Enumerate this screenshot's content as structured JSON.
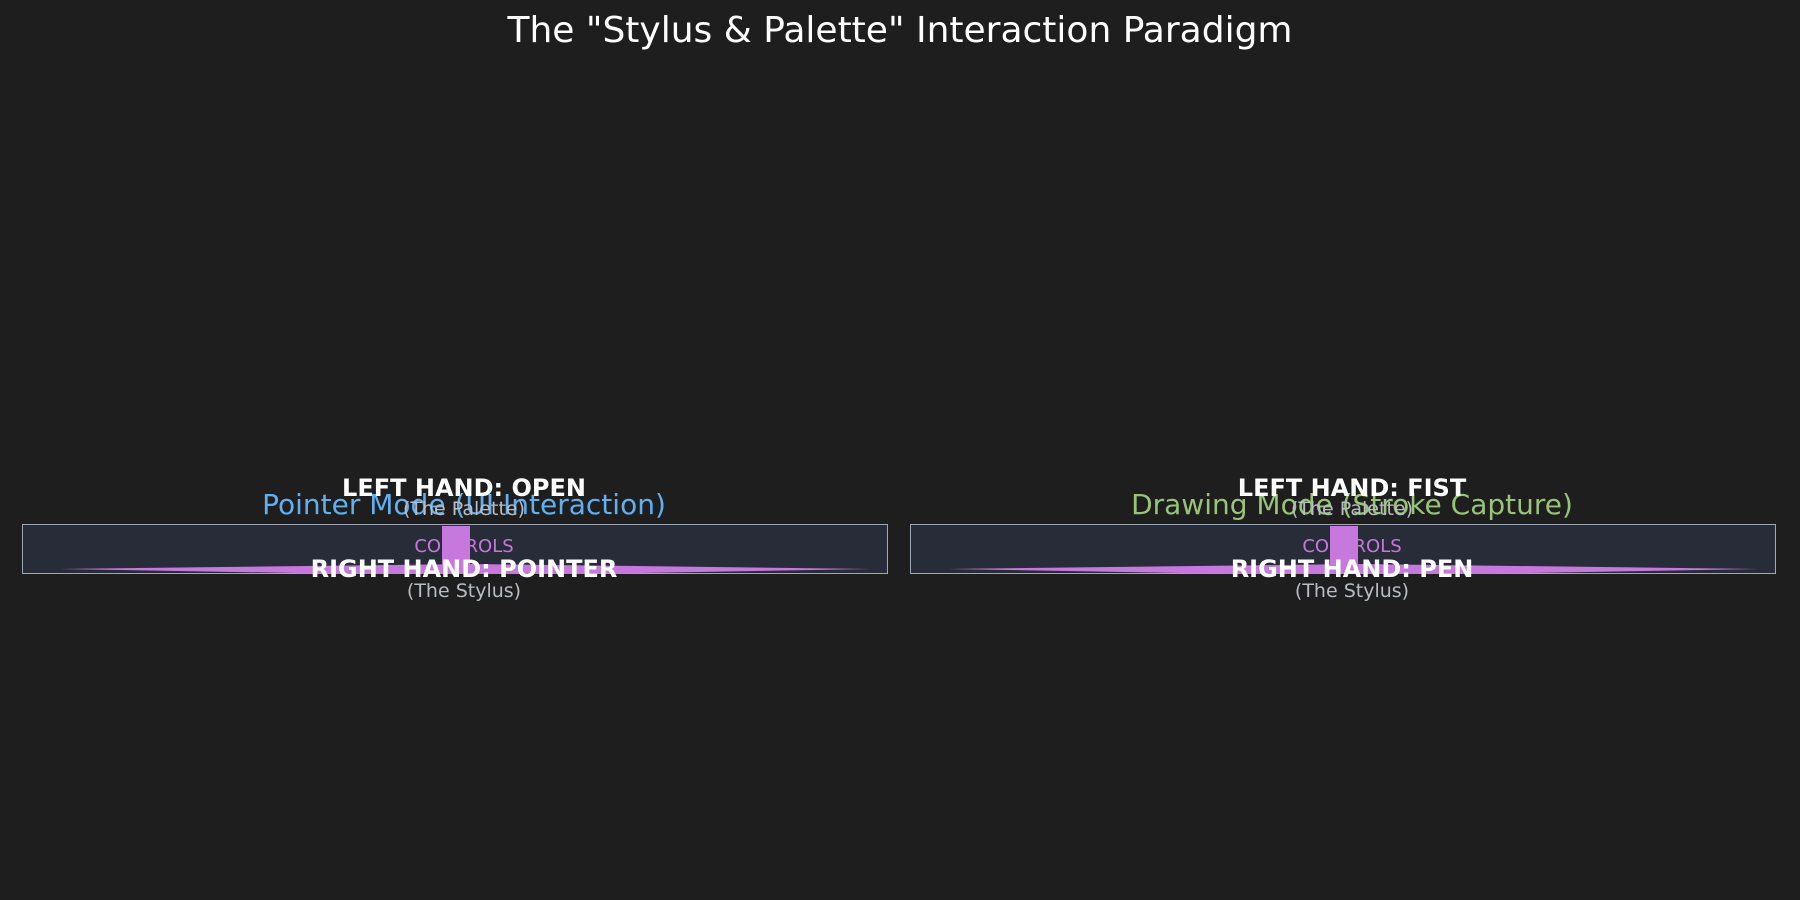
{
  "title": "The \"Stylus & Palette\" Interaction Paradigm",
  "colors": {
    "background": "#1e1e1e",
    "pointer_mode": "#61afef",
    "drawing_mode": "#98c379",
    "accent": "#c678dd"
  },
  "panels": [
    {
      "mode_title": "Pointer Mode (UI Interaction)",
      "left_hand": "LEFT HAND: OPEN",
      "left_hand_role": "(The Palette)",
      "controls_label": "CONTROLS",
      "right_hand": "RIGHT HAND: POINTER",
      "right_hand_role": "(The Stylus)"
    },
    {
      "mode_title": "Drawing Mode (Stroke Capture)",
      "left_hand": "LEFT HAND: FIST",
      "left_hand_role": "(The Palette)",
      "controls_label": "CONTROLS",
      "right_hand": "RIGHT HAND: PEN",
      "right_hand_role": "(The Stylus)"
    }
  ]
}
